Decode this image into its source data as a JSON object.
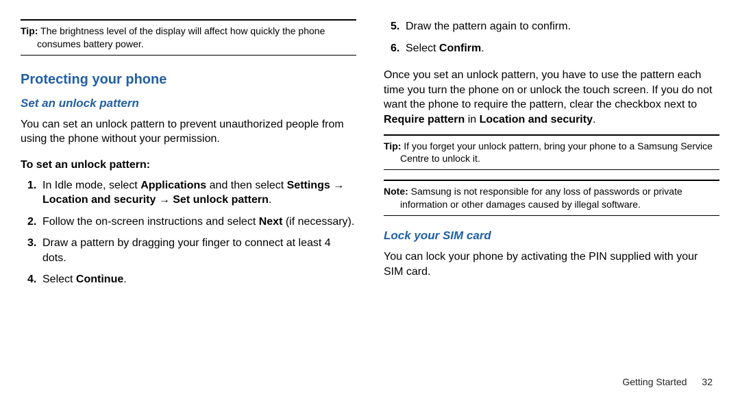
{
  "left": {
    "tip": {
      "label": "Tip:",
      "text": " The brightness level of the display will affect how quickly the phone consumes battery power."
    },
    "h1": "Protecting your phone",
    "h2": "Set an unlock pattern",
    "intro": "You can set an unlock pattern to prevent unauthorized people from using the phone without your permission.",
    "subhead": "To set an unlock pattern:",
    "steps": {
      "s1a": "In Idle mode, select ",
      "s1b": "Applications",
      "s1c": " and then select ",
      "s1d": "Settings → Location and security → Set unlock pattern",
      "s1e": ".",
      "s2a": "Follow the on-screen instructions and select ",
      "s2b": "Next",
      "s2c": " (if necessary).",
      "s3": "Draw a pattern by dragging your finger to connect at least 4 dots.",
      "s4a": "Select ",
      "s4b": "Continue",
      "s4c": "."
    }
  },
  "right": {
    "steps": {
      "s5": "Draw the pattern again to confirm.",
      "s6a": "Select ",
      "s6b": "Confirm",
      "s6c": "."
    },
    "para1a": "Once you set an unlock pattern, you have to use the pattern each time you turn the phone on or unlock the touch screen. If you do not want the phone to require the pattern, clear the checkbox next to ",
    "para1b": "Require pattern",
    "para1c": " in ",
    "para1d": "Location and security",
    "para1e": ".",
    "tip": {
      "label": "Tip:",
      "text": " If you forget your unlock pattern, bring your phone to a Samsung Service Centre to unlock it."
    },
    "note": {
      "label": "Note:",
      "text": " Samsung is not responsible for any loss of passwords or private information or other damages caused by illegal software."
    },
    "h2": "Lock your SIM card",
    "para2": "You can lock your phone by activating the PIN supplied with your SIM card."
  },
  "footer": {
    "section": "Getting Started",
    "page": "32"
  }
}
